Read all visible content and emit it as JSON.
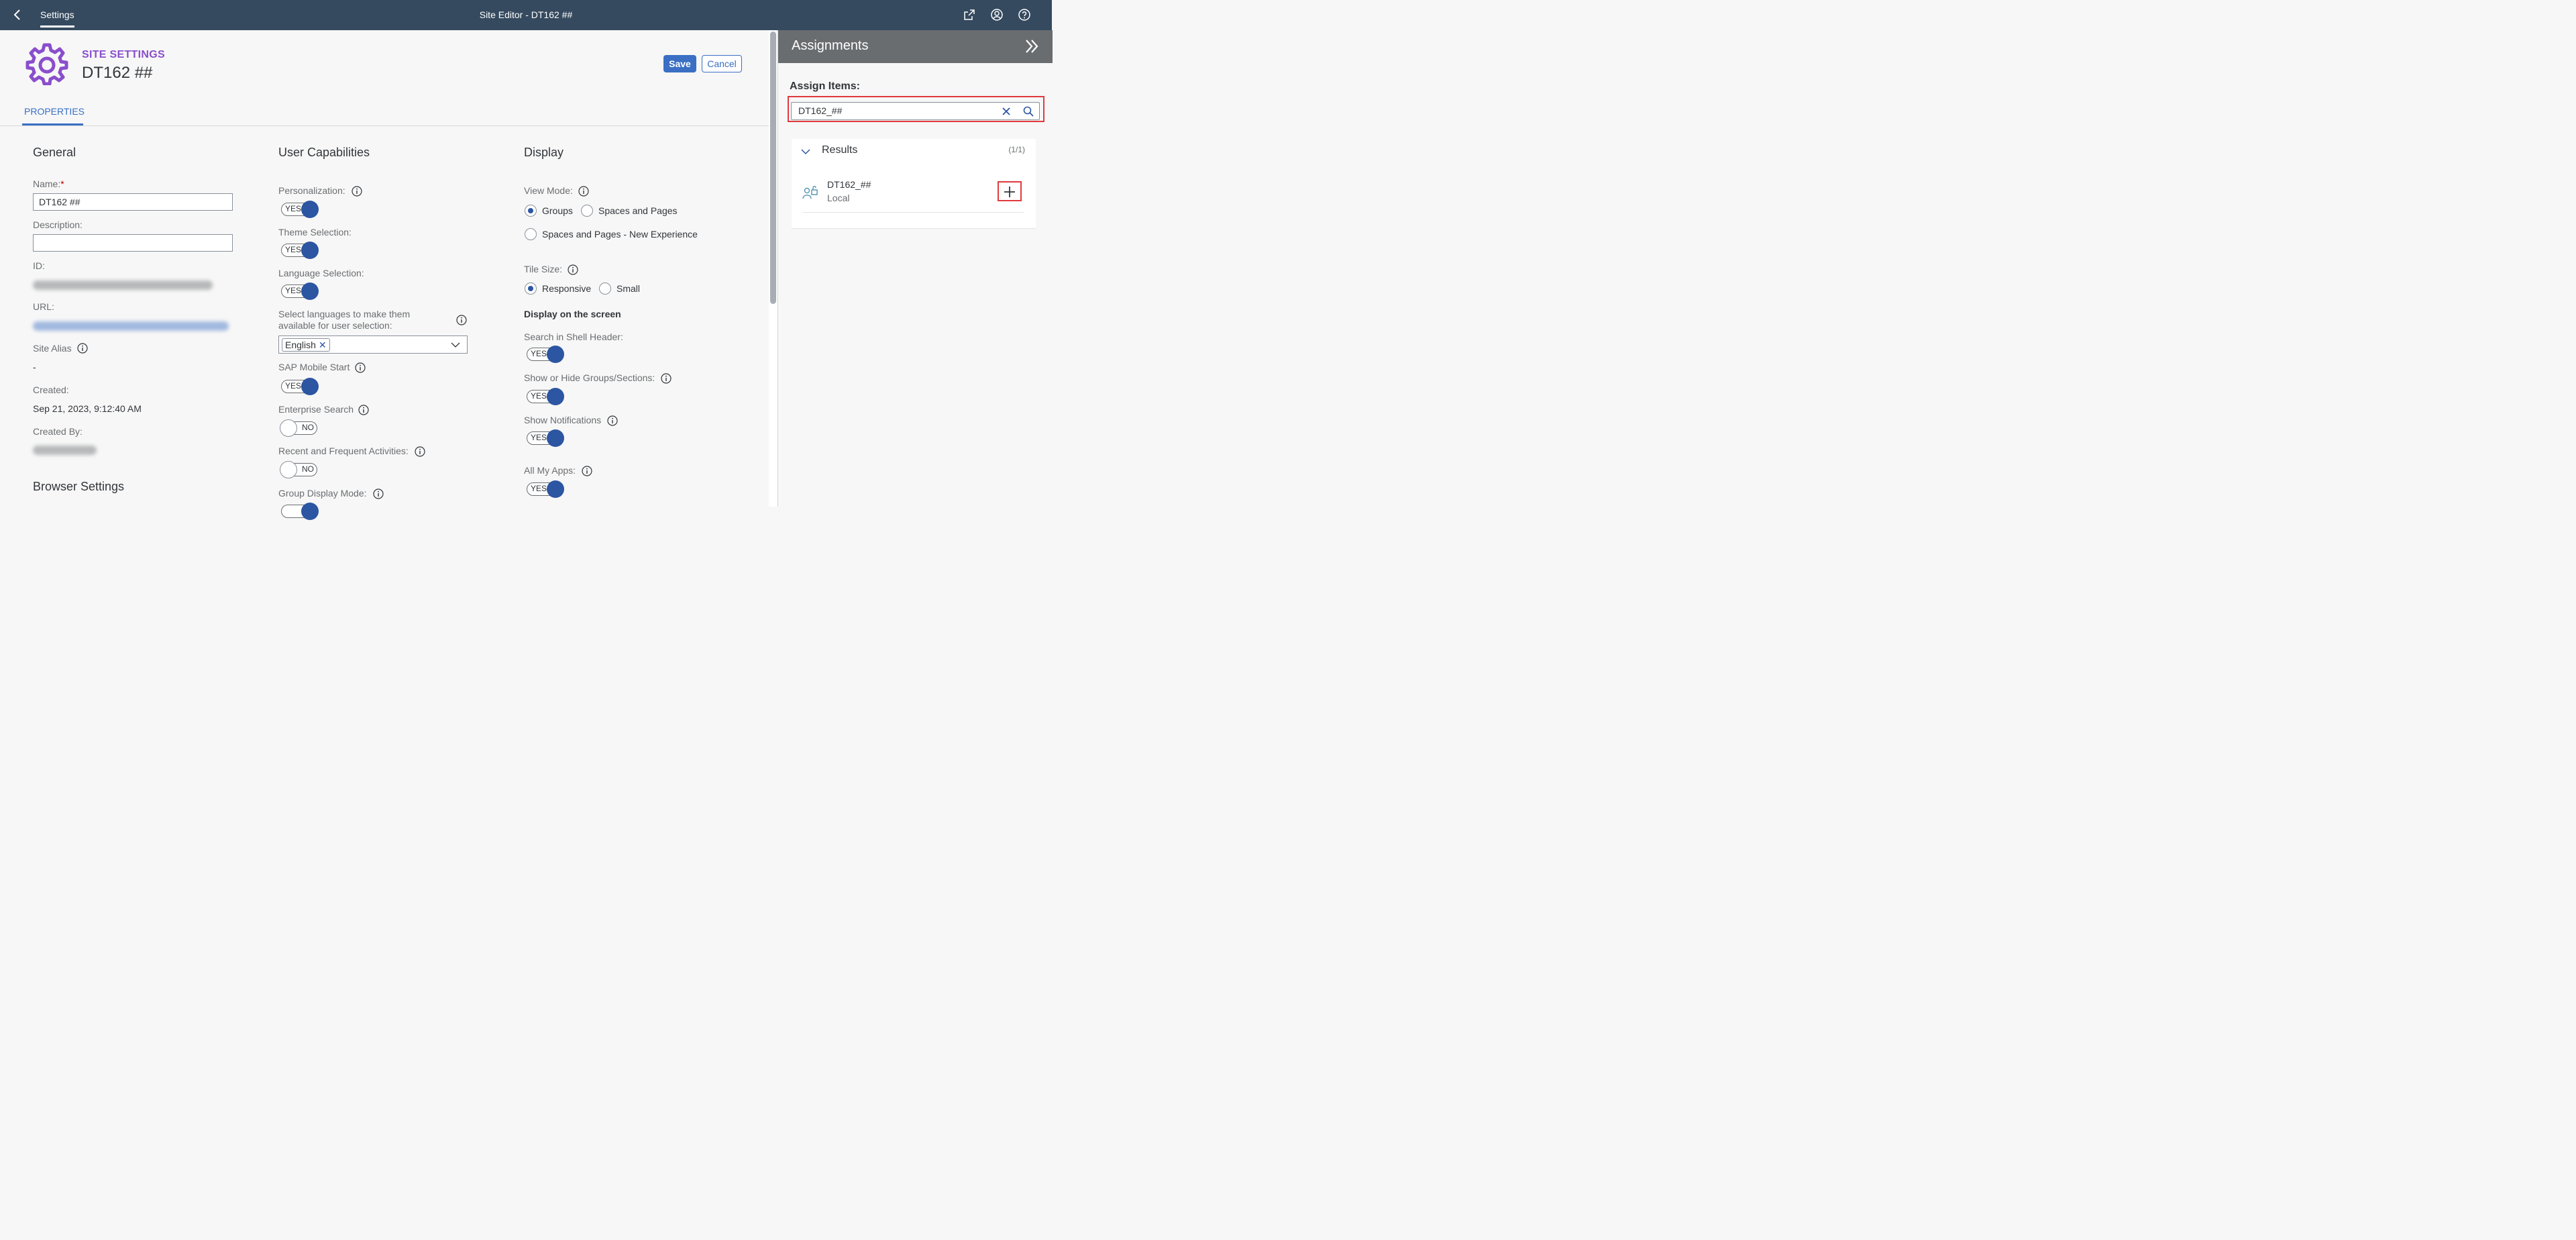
{
  "shell": {
    "back_icon": "chevron-left-icon",
    "tab_label": "Settings",
    "title": "Site Editor - DT162 ##",
    "icons": [
      "share-icon",
      "user-icon",
      "help-icon"
    ]
  },
  "header": {
    "subtitle": "SITE SETTINGS",
    "title": "DT162 ##",
    "save_label": "Save",
    "cancel_label": "Cancel",
    "tab_label": "PROPERTIES"
  },
  "general": {
    "title": "General",
    "name_label": "Name:",
    "name_required": "*",
    "name_value": "DT162 ##",
    "description_label": "Description:",
    "description_value": "",
    "id_label": "ID:",
    "url_label": "URL:",
    "alias_label": "Site Alias",
    "alias_value": "-",
    "created_label": "Created:",
    "created_value": "Sep 21, 2023, 9:12:40 AM",
    "created_by_label": "Created By:",
    "browser_title": "Browser Settings"
  },
  "capabilities": {
    "title": "User Capabilities",
    "personalization_label": "Personalization:",
    "personalization_state": "YES",
    "theme_label": "Theme Selection:",
    "theme_state": "YES",
    "language_label": "Language Selection:",
    "language_state": "YES",
    "languages_select_label": "Select languages to make them available for user selection:",
    "language_token": "English",
    "mobile_label": "SAP Mobile Start",
    "mobile_state": "YES",
    "enterprise_label": "Enterprise Search",
    "enterprise_state": "NO",
    "recent_label": "Recent and Frequent Activities:",
    "recent_state": "NO",
    "group_mode_label": "Group Display Mode:"
  },
  "display": {
    "title": "Display",
    "view_mode_label": "View Mode:",
    "view_groups": "Groups",
    "view_spaces": "Spaces and Pages",
    "view_spaces_new": "Spaces and Pages - New Experience",
    "tile_size_label": "Tile Size:",
    "tile_responsive": "Responsive",
    "tile_small": "Small",
    "screen_heading": "Display on the screen",
    "search_header_label": "Search in Shell Header:",
    "search_header_state": "YES",
    "groups_sections_label": "Show or Hide Groups/Sections:",
    "groups_sections_state": "YES",
    "notifications_label": "Show Notifications",
    "notifications_state": "YES",
    "all_apps_label": "All My Apps:",
    "all_apps_state": "YES"
  },
  "panel": {
    "title": "Assignments",
    "assign_label": "Assign Items:",
    "search_value": "DT162_##",
    "results_title": "Results",
    "results_count": "(1/1)",
    "item_name": "DT162_##",
    "item_sub": "Local"
  },
  "colors": {
    "shell_bg": "#354a5f",
    "accent": "#3a6fc4",
    "subtitle": "#8a4ecc",
    "toggle_on": "#2c55a2",
    "highlight": "#e03a3e"
  }
}
